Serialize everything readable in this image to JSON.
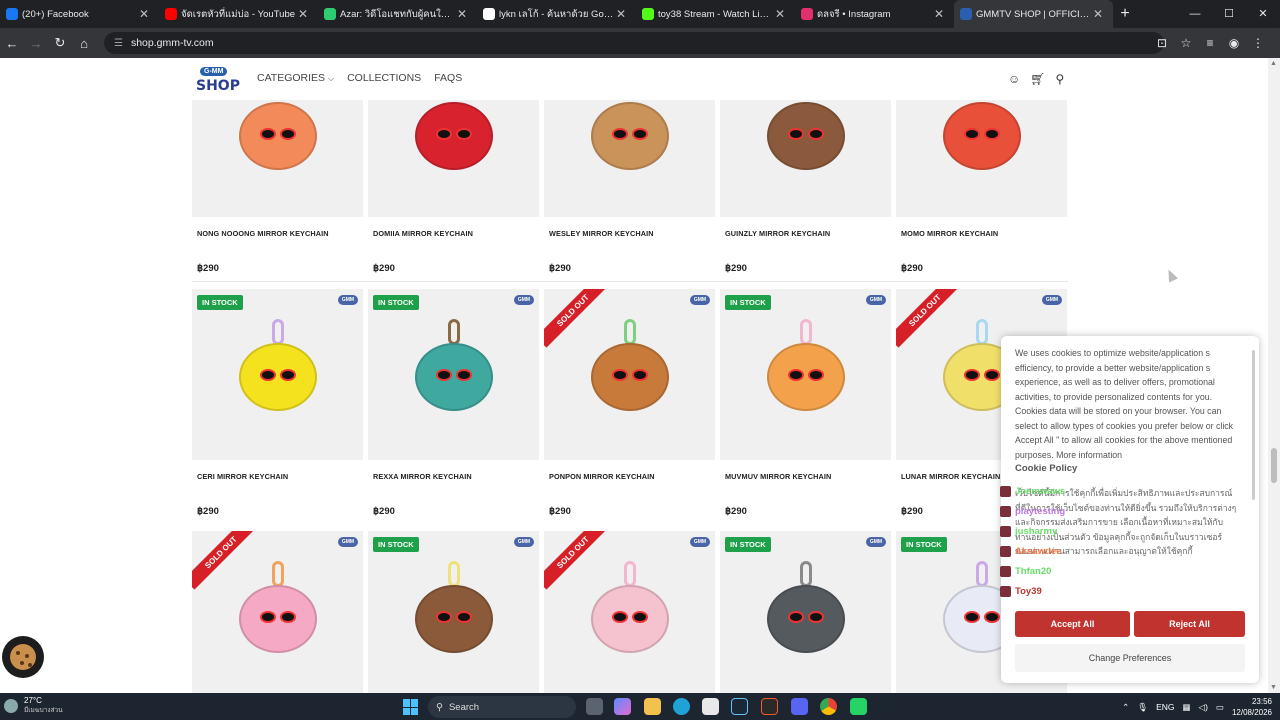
{
  "browser": {
    "tabs": [
      {
        "title": "(20+) Facebook",
        "color": "#1877f2",
        "active": false
      },
      {
        "title": "จัดเรตหัวที่แม่บ่อ - YouTube",
        "color": "#ff0000",
        "active": false
      },
      {
        "title": "Azar: วิดีโอแชทกับผู้คนใหม่ๆ",
        "color": "#2ecc71",
        "active": false
      },
      {
        "title": "lykn เลโก้ - ค้นหาด้วย Google",
        "color": "#ffffff",
        "active": false
      },
      {
        "title": "toy38 Stream - Watch Live on K",
        "color": "#53fc18",
        "active": false
      },
      {
        "title": "ดลจรี • Instagram",
        "color": "#e1306c",
        "active": false
      },
      {
        "title": "GMMTV SHOP | OFFICIAL STOR",
        "color": "#2a5fb0",
        "active": true
      }
    ],
    "new_tab": "+",
    "url": "shop.gmm-tv.com",
    "win_min": "—",
    "win_max": "☐",
    "win_close": "✕"
  },
  "site": {
    "logo_top": "G-MM",
    "logo_bottom": "SHOP",
    "nav": {
      "categories": "CATEGORIES",
      "collections": "COLLECTIONS",
      "faqs": "FAQS"
    }
  },
  "products": {
    "row1": [
      {
        "name": "NONG NOOONG MIRROR KEYCHAIN",
        "price": "฿290",
        "color": "#f28a5a"
      },
      {
        "name": "DOMIIA MIRROR KEYCHAIN",
        "price": "฿290",
        "color": "#d8232f"
      },
      {
        "name": "WESLEY MIRROR KEYCHAIN",
        "price": "฿290",
        "color": "#c9935a"
      },
      {
        "name": "GUINZLY MIRROR KEYCHAIN",
        "price": "฿290",
        "color": "#8b5a3c"
      },
      {
        "name": "MOMO MIRROR KEYCHAIN",
        "price": "฿290",
        "color": "#e8503a"
      }
    ],
    "row2": [
      {
        "name": "CERI MIRROR KEYCHAIN",
        "price": "฿290",
        "status": "IN STOCK",
        "color": "#f5e21f",
        "ring": "#c9a9e8"
      },
      {
        "name": "REXXA MIRROR KEYCHAIN",
        "price": "฿290",
        "status": "IN STOCK",
        "color": "#3fa9a0",
        "ring": "#8a6a45"
      },
      {
        "name": "PONPON MIRROR KEYCHAIN",
        "price": "฿290",
        "status": "SOLD OUT",
        "color": "#c87a3a",
        "ring": "#7ecf7e"
      },
      {
        "name": "MUVMUV MIRROR KEYCHAIN",
        "price": "฿290",
        "status": "IN STOCK",
        "color": "#f3a24b",
        "ring": "#f2b6d0"
      },
      {
        "name": "LUNAR MIRROR KEYCHAIN",
        "price": "฿290",
        "status": "SOLD OUT",
        "color": "#f0e06a",
        "ring": "#a9d8f2"
      }
    ],
    "row3": [
      {
        "status": "SOLD OUT",
        "color": "#f5a9c4",
        "ring": "#f2a25a"
      },
      {
        "status": "IN STOCK",
        "color": "#8a5a3a",
        "ring": "#f2e07a"
      },
      {
        "status": "SOLD OUT",
        "color": "#f5c2cf",
        "ring": "#f2b6d0"
      },
      {
        "status": "IN STOCK",
        "color": "#555a5f",
        "ring": "#8a8a8a"
      },
      {
        "status": "IN STOCK",
        "color": "#e8eaf5",
        "ring": "#c9a9e8"
      }
    ],
    "brand_badge": "GMM"
  },
  "cookie": {
    "text": "We uses cookies to optimize website/application s efficiency, to provide a better website/application s experience, as well as to deliver offers, promotional activities, to provide personalized contents for you. Cookies data will be stored on your browser. You can select to allow types of cookies you prefer below or click Accept All \" to allow all cookies for the above mentioned purposes. More information",
    "policy": "Cookie Policy",
    "thai": "เว็บไซต์นี้มีการใช้คุกกี้เพื่อเพิ่มประสิทธิภาพและประสบการณ์ที่ดีในการใช้เว็บไซต์ของท่านให้ดียิ่งขึ้น รวมถึงให้บริการต่างๆ และกิจกรรมส่งเสริมการขาย เลือกเนื้อหาที่เหมาะสมให้กับท่านอย่างเป็นส่วนตัว ข้อมูลคุกกี้จะถูกจัดเก็บในบราวเซอร์ของท่าน ท่านสามารถเลือกและอนุญาตให้ใช้คุกกี้",
    "accept": "Accept All",
    "reject": "Reject All",
    "prefs": "Change Preferences"
  },
  "chat": [
    {
      "user": "Joemwaws",
      "color": "#6adb6a"
    },
    {
      "user": "playtesting",
      "color": "#c07ae0"
    },
    {
      "user": "jusharmy",
      "color": "#6adb6a"
    },
    {
      "user": "Aksawdee",
      "color": "#f07a4a"
    },
    {
      "user": "Thfan20",
      "color": "#6adb6a"
    },
    {
      "user": "Toy39",
      "color": "#c0332e"
    }
  ],
  "taskbar": {
    "temp": "27°C",
    "weather": "มีเมฆบางส่วน",
    "search": "Search",
    "lang": "ENG",
    "time": "23:56",
    "date": "12/08/2026"
  }
}
